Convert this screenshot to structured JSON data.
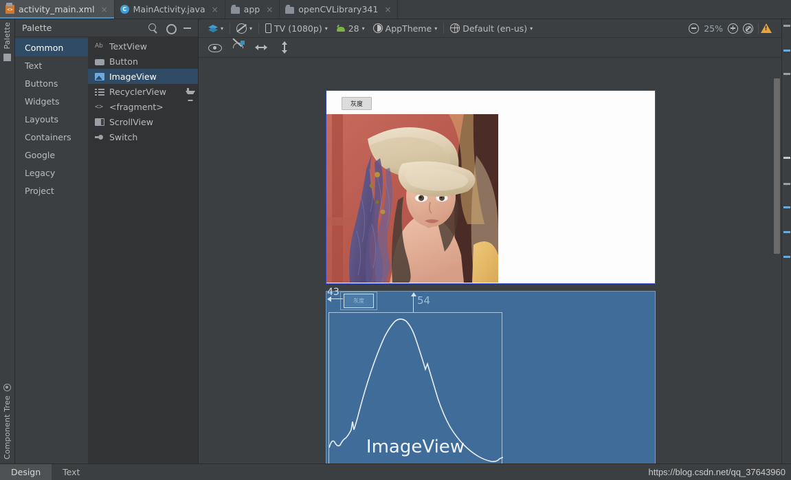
{
  "tabs": [
    {
      "label": "activity_main.xml",
      "icon": "xml-file-icon",
      "active": true,
      "close": "×"
    },
    {
      "label": "MainActivity.java",
      "icon": "java-class-icon",
      "active": false,
      "close": "×"
    },
    {
      "label": "app",
      "icon": "android-module-icon",
      "active": false,
      "close": "×"
    },
    {
      "label": "openCVLibrary341",
      "icon": "android-module-icon",
      "active": false,
      "close": "×"
    }
  ],
  "left_rail": {
    "palette_label": "Palette",
    "component_tree_label": "Component Tree"
  },
  "palette": {
    "title": "Palette",
    "search_icon": "search-icon",
    "gear_icon": "gear-icon",
    "minimize_icon": "minimize-icon",
    "categories": [
      {
        "label": "Common",
        "selected": true
      },
      {
        "label": "Text",
        "selected": false
      },
      {
        "label": "Buttons",
        "selected": false
      },
      {
        "label": "Widgets",
        "selected": false
      },
      {
        "label": "Layouts",
        "selected": false
      },
      {
        "label": "Containers",
        "selected": false
      },
      {
        "label": "Google",
        "selected": false
      },
      {
        "label": "Legacy",
        "selected": false
      },
      {
        "label": "Project",
        "selected": false
      }
    ],
    "items": [
      {
        "label": "TextView",
        "glyph": "g-text",
        "selected": false,
        "download": false
      },
      {
        "label": "Button",
        "glyph": "g-button",
        "selected": false,
        "download": false
      },
      {
        "label": "ImageView",
        "glyph": "g-image",
        "selected": true,
        "download": false
      },
      {
        "label": "RecyclerView",
        "glyph": "g-recycler",
        "selected": false,
        "download": true
      },
      {
        "label": "<fragment>",
        "glyph": "g-fragment",
        "selected": false,
        "download": false
      },
      {
        "label": "ScrollView",
        "glyph": "g-scroll",
        "selected": false,
        "download": false
      },
      {
        "label": "Switch",
        "glyph": "g-switch",
        "selected": false,
        "download": false
      }
    ]
  },
  "toolbar": {
    "design_mode_icon": "layers-icon",
    "blueprint_mode_icon": "blueprint-orientation-icon",
    "device_icon": "phone-icon",
    "device": "TV (1080p)",
    "api_icon": "android-icon",
    "api_level": "28",
    "theme_icon": "theme-contrast-icon",
    "theme": "AppTheme",
    "locale_icon": "globe-icon",
    "locale": "Default (en-us)",
    "zoom_out_icon": "zoom-out-icon",
    "zoom_level": "25%",
    "zoom_in_icon": "zoom-in-icon",
    "zoom_fit_icon": "zoom-to-fit-icon",
    "warning_icon": "warning-icon",
    "caret": "▾"
  },
  "surface_toolbar": {
    "show_constraints_icon": "eye-icon",
    "autoconnect_icon": "magnet-icon",
    "expand_horizontal_icon": "horizontal-arrow-icon",
    "expand_vertical_icon": "vertical-arrow-icon"
  },
  "canvas": {
    "preview": {
      "button_label": "灰度",
      "image_name": "lenna-test-image"
    },
    "blueprint": {
      "button_label": "灰度",
      "constraint_left": "43",
      "constraint_top": "54",
      "imageview_label": "ImageView",
      "curve_name": "histogram-curve"
    }
  },
  "bottom": {
    "tabs": [
      {
        "label": "Design",
        "active": true
      },
      {
        "label": "Text",
        "active": false
      }
    ],
    "watermark": "https://blog.csdn.net/qq_37643960"
  },
  "colors": {
    "accent": "#3d9dd4",
    "selection": "#2f4b66",
    "blueprint_bg": "#3f6c99",
    "blueprint_line": "#aac5de",
    "warning": "#e8a33d",
    "android_green": "#7cb342",
    "device_border": "#2f49c9"
  }
}
